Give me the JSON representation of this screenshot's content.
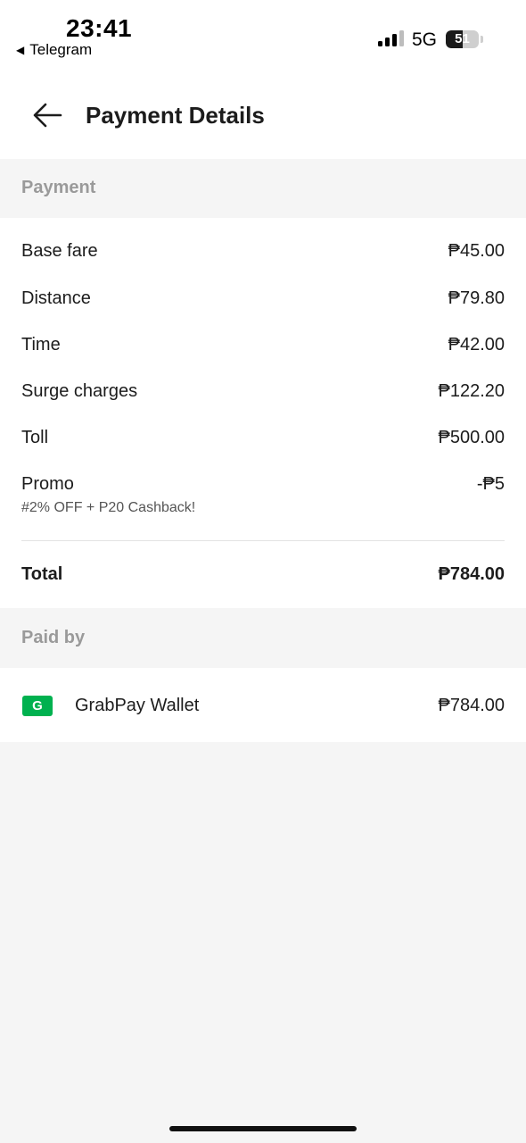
{
  "status_bar": {
    "time": "23:41",
    "back_app": "Telegram",
    "network": "5G",
    "battery_percent": "51",
    "battery_level": 0.51
  },
  "header": {
    "title": "Payment Details",
    "back_icon": "arrow-left-icon"
  },
  "payment": {
    "section_title": "Payment",
    "items": [
      {
        "label": "Base fare",
        "amount": "₱45.00"
      },
      {
        "label": "Distance",
        "amount": "₱79.80"
      },
      {
        "label": "Time",
        "amount": "₱42.00"
      },
      {
        "label": "Surge charges",
        "amount": "₱122.20"
      },
      {
        "label": "Toll",
        "amount": "₱500.00"
      },
      {
        "label": "Promo",
        "amount": "-₱5",
        "subtext": "#2% OFF + P20 Cashback!"
      }
    ],
    "total_label": "Total",
    "total_amount": "₱784.00"
  },
  "paid_by": {
    "section_title": "Paid by",
    "method_icon_letter": "G",
    "method_label": "GrabPay Wallet",
    "method_amount": "₱784.00",
    "brand_color": "#00b14f"
  }
}
